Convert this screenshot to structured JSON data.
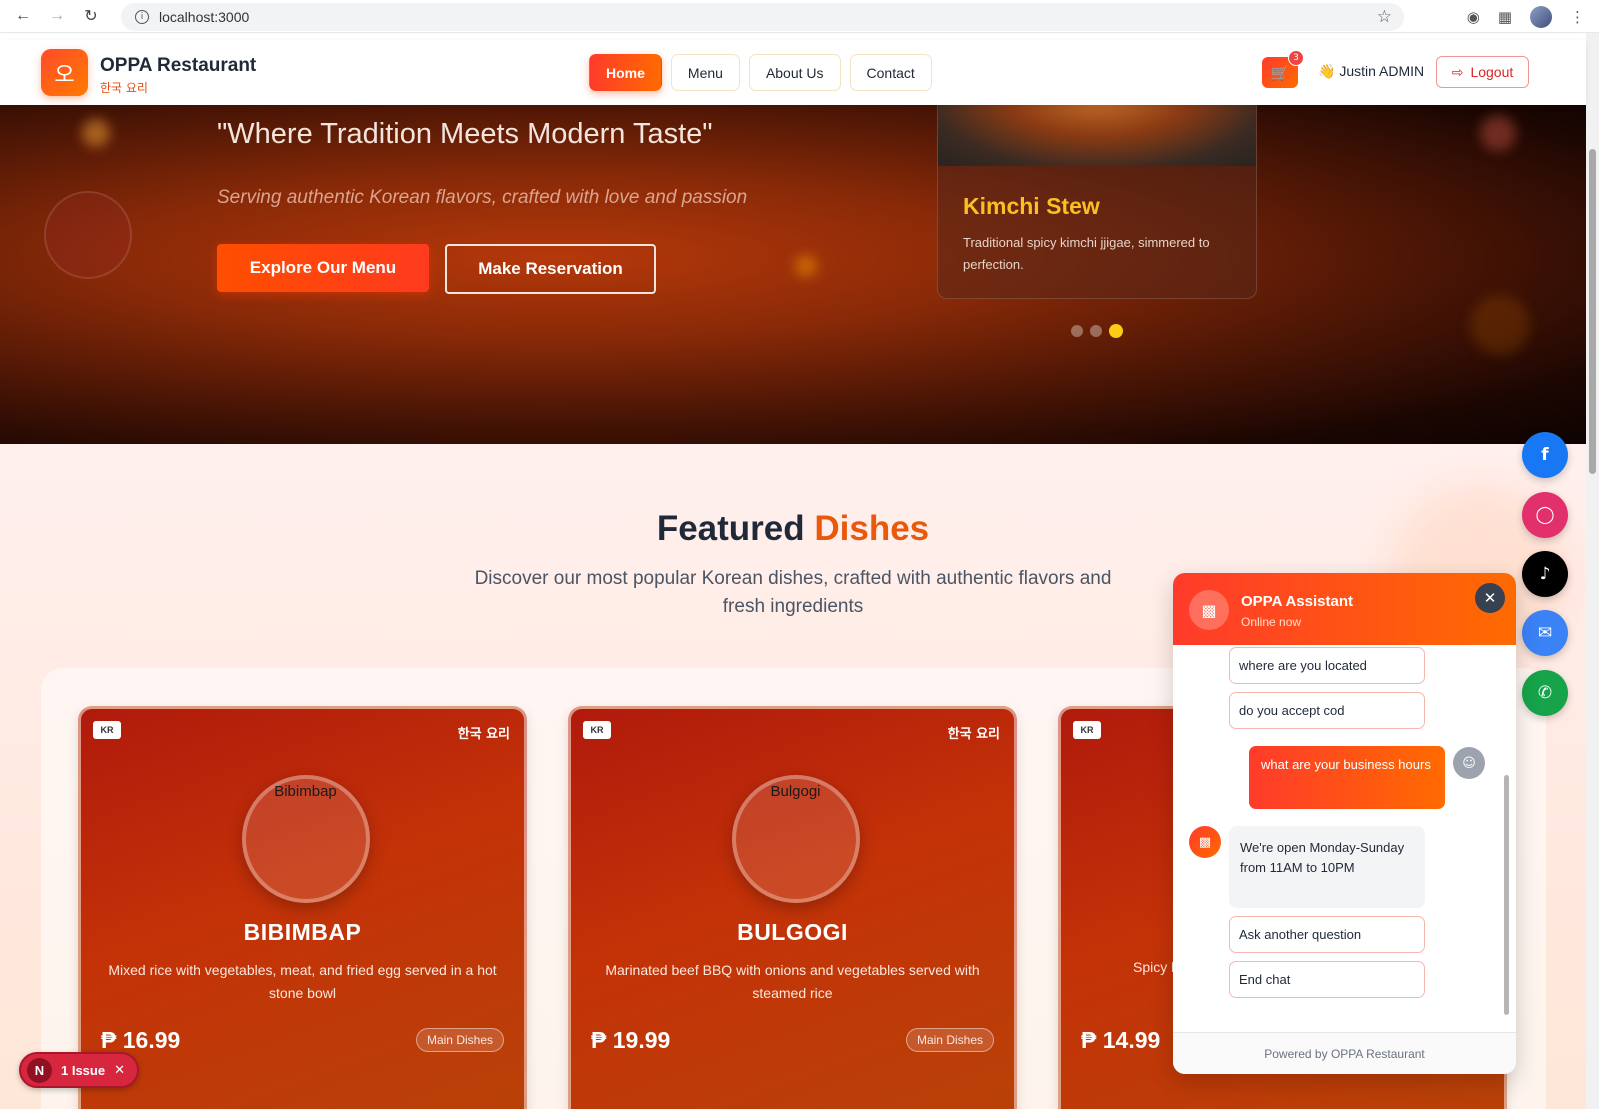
{
  "browser": {
    "url": "localhost:3000"
  },
  "header": {
    "logo_glyph": "오",
    "brand": "OPPA Restaurant",
    "brand_sub": "한국 요리",
    "nav": [
      "Home",
      "Menu",
      "About Us",
      "Contact"
    ],
    "active_nav": "Home",
    "cart_count": "3",
    "user": "👋 Justin ADMIN",
    "logout": "Logout"
  },
  "hero": {
    "quote": "\"Where Tradition Meets Modern Taste\"",
    "subtitle": "Serving authentic Korean flavors, crafted with love and passion",
    "explore_label": "Explore Our Menu",
    "reserve_label": "Make Reservation",
    "slide": {
      "title": "Kimchi Stew",
      "description": "Traditional spicy kimchi jjigae, simmered to perfection."
    },
    "slide_count": 3,
    "active_slide": 3
  },
  "featured": {
    "title_main": "Featured",
    "title_accent": "Dishes",
    "description": "Discover our most popular Korean dishes, crafted with authentic flavors and fresh ingredients",
    "cards": [
      {
        "tag": "KR",
        "hangul": "한국 요리",
        "image_alt": "Bibimbap",
        "name": "BIBIMBAP",
        "description": "Mixed rice with vegetables, meat, and fried egg served in a hot stone bowl",
        "price": "₱ 16.99",
        "category": "Main Dishes"
      },
      {
        "tag": "KR",
        "hangul": "한국 요리",
        "image_alt": "Bulgogi",
        "name": "BULGOGI",
        "description": "Marinated beef BBQ with onions and vegetables served with steamed rice",
        "price": "₱ 19.99",
        "category": "Main Dishes"
      },
      {
        "tag": "KR",
        "description_fragment": "Spicy k",
        "price": "₱ 14.99"
      }
    ]
  },
  "chat": {
    "title": "OPPA Assistant",
    "status": "Online now",
    "options_top": [
      "where are you located",
      "do you accept cod"
    ],
    "user_message": "what are your business hours",
    "bot_message": "We're open Monday-Sunday from 11AM to 10PM",
    "options_bottom": [
      "Ask another question",
      "End chat"
    ],
    "footer": "Powered by OPPA Restaurant"
  },
  "social": [
    "facebook-icon",
    "instagram-icon",
    "tiktok-icon",
    "mail-icon",
    "phone-icon"
  ],
  "dev_overlay": {
    "badge": "N",
    "label": "1 Issue"
  },
  "colors": {
    "accent": "#ff5a14",
    "brand_orange": "#ea580c",
    "facebook": "#1877f2",
    "instagram": "#e1306c",
    "tiktok": "#000000",
    "mail": "#3b82f6",
    "phone": "#16a34a",
    "slide_title": "#fbbf24"
  }
}
